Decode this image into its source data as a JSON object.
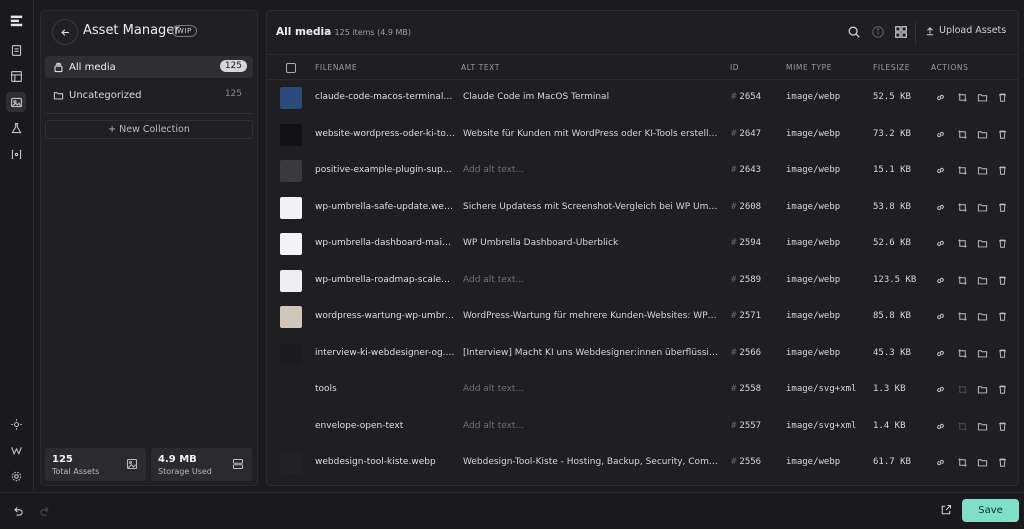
{
  "colors": {
    "accent": "#7fe0c8",
    "background": "#1b1b1d",
    "panel": "#202023"
  },
  "rail": {
    "icons": [
      "logo-icon",
      "page-icon",
      "layout-icon",
      "media-icon",
      "flask-icon",
      "variable-icon",
      "sun-icon",
      "wordpress-icon",
      "gear-icon"
    ]
  },
  "sidebar": {
    "title": "Asset Manager",
    "badge": "WIP",
    "collections": [
      {
        "label": "All media",
        "count": "125",
        "icon": "library-icon"
      },
      {
        "label": "Uncategorized",
        "count": "125",
        "icon": "folder-icon"
      }
    ],
    "new_collection": "+ New Collection",
    "stats": [
      {
        "value": "125",
        "label": "Total Assets",
        "icon": "image-icon"
      },
      {
        "value": "4.9 MB",
        "label": "Storage Used",
        "icon": "storage-icon"
      }
    ]
  },
  "main": {
    "title": "All media",
    "subtitle": "— 125 items (4.9 MB)",
    "upload_label": "Upload Assets",
    "columns": [
      "FILENAME",
      "ALT TEXT",
      "ID",
      "MIME TYPE",
      "FILESIZE",
      "ACTIONS"
    ],
    "alt_placeholder": "Add alt text...",
    "rows": [
      {
        "filename": "claude-code-macos-terminal.webp",
        "alt": "Claude Code im MacOS Terminal",
        "id": "2654",
        "mime": "image/webp",
        "size": "52.5 KB",
        "thumb": "#2a4a7a"
      },
      {
        "filename": "website-wordpress-oder-ki-tools.webp",
        "alt": "Website für Kunden mit WordPress oder KI-Tools erstellen?",
        "id": "2647",
        "mime": "image/webp",
        "size": "73.2 KB",
        "thumb": "#111114"
      },
      {
        "filename": "positive-example-plugin-support.webp",
        "alt": "",
        "id": "2643",
        "mime": "image/webp",
        "size": "15.1 KB",
        "thumb": "#3a3a3e"
      },
      {
        "filename": "wp-umbrella-safe-update.webp",
        "alt": "Sichere Updatess mit Screenshot-Vergleich bei WP Umbrella",
        "id": "2608",
        "mime": "image/webp",
        "size": "53.8 KB",
        "thumb": "#f2f2f4"
      },
      {
        "filename": "wp-umbrella-dashboard-main.webp",
        "alt": "WP Umbrella Dashboard-Überblick",
        "id": "2594",
        "mime": "image/webp",
        "size": "52.6 KB",
        "thumb": "#f4f4f6"
      },
      {
        "filename": "wp-umbrella-roadmap-scaled.webp",
        "alt": "",
        "id": "2589",
        "mime": "image/webp",
        "size": "123.5 KB",
        "thumb": "#eeeef0"
      },
      {
        "filename": "wordpress-wartung-wp-umbrella.webp",
        "alt": "WordPress-Wartung für mehrere Kunden-Websites: WP Umbrella",
        "id": "2571",
        "mime": "image/webp",
        "size": "85.8 KB",
        "thumb": "#cfc8b8"
      },
      {
        "filename": "interview-ki-webdesigner-og.webp",
        "alt": "[Interview] Macht KI uns Webdesigner:innen überflüssig?",
        "id": "2566",
        "mime": "image/webp",
        "size": "45.3 KB",
        "thumb": "#1c1c1e"
      },
      {
        "filename": "tools",
        "alt": "",
        "id": "2558",
        "mime": "image/svg+xml",
        "size": "1.3 KB",
        "thumb": "#1f1f22"
      },
      {
        "filename": "envelope-open-text",
        "alt": "",
        "id": "2557",
        "mime": "image/svg+xml",
        "size": "1.4 KB",
        "thumb": "#1f1f22"
      },
      {
        "filename": "webdesign-tool-kiste.webp",
        "alt": "Webdesign-Tool-Kiste - Hosting, Backup, Security, Community",
        "id": "2556",
        "mime": "image/webp",
        "size": "61.7 KB",
        "thumb": "#222226"
      }
    ]
  },
  "footer": {
    "save_label": "Save"
  }
}
